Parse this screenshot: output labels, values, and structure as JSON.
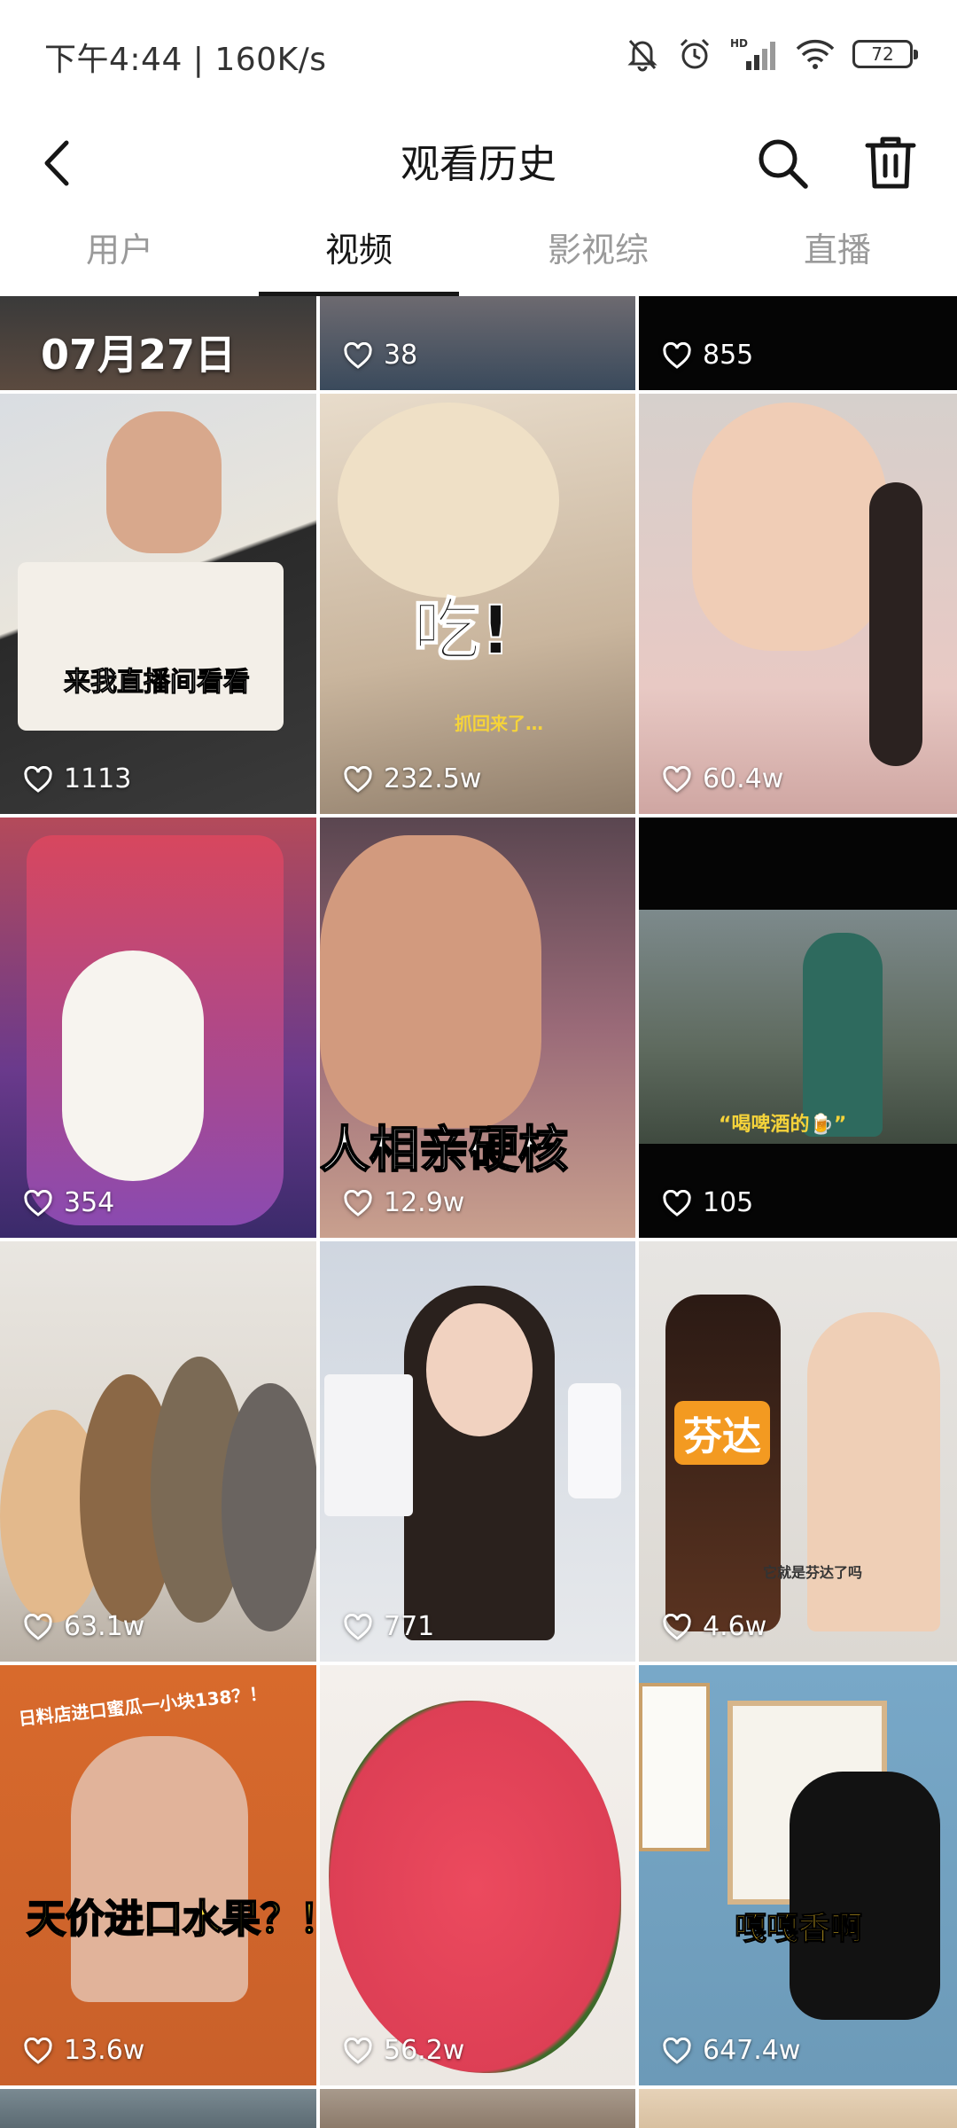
{
  "status_bar": {
    "time_speed": "下午4:44 | 160K/s",
    "battery": "72",
    "icons": [
      "mute-bell-icon",
      "alarm-icon",
      "hd-signal-icon",
      "wifi-icon",
      "battery-icon"
    ]
  },
  "header": {
    "title": "观看历史",
    "icons": [
      "back-arrow-icon",
      "search-icon",
      "trash-icon"
    ]
  },
  "tabs": [
    {
      "label": "用户",
      "active": false
    },
    {
      "label": "视频",
      "active": true
    },
    {
      "label": "影视综",
      "active": false
    },
    {
      "label": "直播",
      "active": false
    }
  ],
  "date_label": "07月27日",
  "videos": [
    {
      "likes": "38"
    },
    {
      "likes": "855"
    },
    {
      "likes": "1113",
      "caption": "来我直播间看看"
    },
    {
      "likes": "232.5w",
      "caption": "吃!",
      "subcaption": "抓回来了…"
    },
    {
      "likes": "60.4w"
    },
    {
      "likes": "354"
    },
    {
      "likes": "12.9w",
      "caption": "人相亲硬核"
    },
    {
      "likes": "105",
      "caption": "“喝啤酒的🍺”"
    },
    {
      "likes": "63.1w"
    },
    {
      "likes": "771"
    },
    {
      "likes": "4.6w",
      "caption": "芬达",
      "subcaption": "它就是芬达了吗"
    },
    {
      "likes": "13.6w",
      "caption": "天价进口水果？！",
      "subcaption": "日料店进口蜜瓜一小块138？！"
    },
    {
      "likes": "56.2w"
    },
    {
      "likes": "647.4w",
      "caption": "嘎嘎香啊"
    }
  ],
  "colors": {
    "active_text": "#161616",
    "inactive_text": "#9a9a9a",
    "like_text": "#ffffff"
  }
}
